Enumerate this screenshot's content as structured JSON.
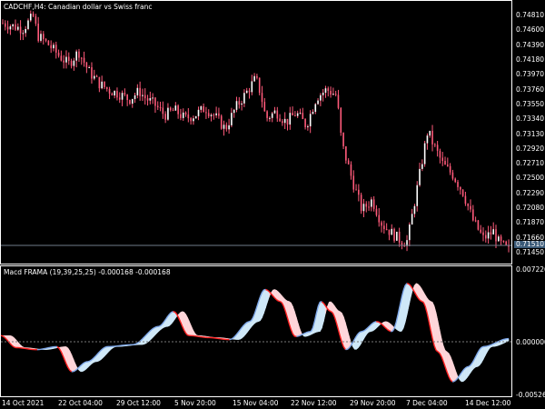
{
  "colors": {
    "background": "#000000",
    "frame": "#ffffff",
    "candle": "#ff5a7a",
    "candle_dark": "#b02040",
    "hist_up": "#cfe8f8",
    "hist_down": "#ffd6da",
    "line_up": "#7da6e8",
    "line_down": "#ff2020",
    "bid_line": "#6f7d8a",
    "bid_tag": "#3a5a78"
  },
  "chart": {
    "title": "CADCHF,H4: Canadian dollar vs Swiss franc",
    "price_ticks": [
      "0.74810",
      "0.74600",
      "0.74390",
      "0.74180",
      "0.73970",
      "0.73760",
      "0.73550",
      "0.73340",
      "0.73130",
      "0.72920",
      "0.72710",
      "0.72500",
      "0.72290",
      "0.72080",
      "0.71870",
      "0.71660",
      "0.71450"
    ],
    "bid_price": "0.71510"
  },
  "indicator": {
    "title": "Macd FRAMA (19,39,25,25) -0.000168 -0.000168",
    "ticks": [
      "0.007226",
      "0.000000",
      "-0.005262"
    ]
  },
  "time_axis": {
    "labels": [
      "14 Oct 2021",
      "22 Oct 04:00",
      "29 Oct 12:00",
      "5 Nov 20:00",
      "15 Nov 04:00",
      "22 Nov 12:00",
      "29 Nov 20:00",
      "7 Dec 04:00",
      "14 Dec 12:00"
    ]
  },
  "chart_data": {
    "type": "line",
    "title": "CADCHF,H4: Canadian dollar vs Swiss franc",
    "xlabel": "",
    "ylabel": "",
    "x_ticks": [
      "14 Oct 2021",
      "22 Oct 04:00",
      "29 Oct 12:00",
      "5 Nov 20:00",
      "15 Nov 04:00",
      "22 Nov 12:00",
      "29 Nov 20:00",
      "7 Dec 04:00",
      "14 Dec 12:00"
    ],
    "ylim": [
      0.714,
      0.7492
    ],
    "close_points": [
      [
        0,
        0.747
      ],
      [
        0.02,
        0.7466
      ],
      [
        0.04,
        0.7462
      ],
      [
        0.06,
        0.748
      ],
      [
        0.07,
        0.7452
      ],
      [
        0.09,
        0.744
      ],
      [
        0.11,
        0.7425
      ],
      [
        0.13,
        0.7412
      ],
      [
        0.15,
        0.743
      ],
      [
        0.17,
        0.7402
      ],
      [
        0.19,
        0.7385
      ],
      [
        0.21,
        0.7375
      ],
      [
        0.23,
        0.737
      ],
      [
        0.25,
        0.7362
      ],
      [
        0.27,
        0.7374
      ],
      [
        0.28,
        0.7365
      ],
      [
        0.3,
        0.7355
      ],
      [
        0.32,
        0.734
      ],
      [
        0.34,
        0.7347
      ],
      [
        0.36,
        0.7335
      ],
      [
        0.38,
        0.734
      ],
      [
        0.4,
        0.735
      ],
      [
        0.42,
        0.7338
      ],
      [
        0.44,
        0.732
      ],
      [
        0.46,
        0.735
      ],
      [
        0.48,
        0.737
      ],
      [
        0.5,
        0.7392
      ],
      [
        0.51,
        0.737
      ],
      [
        0.52,
        0.7335
      ],
      [
        0.54,
        0.7345
      ],
      [
        0.56,
        0.733
      ],
      [
        0.58,
        0.7343
      ],
      [
        0.6,
        0.7325
      ],
      [
        0.62,
        0.7365
      ],
      [
        0.64,
        0.7376
      ],
      [
        0.66,
        0.7368
      ],
      [
        0.67,
        0.73
      ],
      [
        0.69,
        0.725
      ],
      [
        0.71,
        0.7205
      ],
      [
        0.73,
        0.722
      ],
      [
        0.75,
        0.7185
      ],
      [
        0.77,
        0.7172
      ],
      [
        0.79,
        0.716
      ],
      [
        0.8,
        0.7162
      ],
      [
        0.82,
        0.724
      ],
      [
        0.84,
        0.7318
      ],
      [
        0.85,
        0.73
      ],
      [
        0.87,
        0.727
      ],
      [
        0.89,
        0.7255
      ],
      [
        0.91,
        0.723
      ],
      [
        0.93,
        0.719
      ],
      [
        0.95,
        0.7165
      ],
      [
        0.97,
        0.7175
      ],
      [
        0.98,
        0.716
      ],
      [
        1.0,
        0.7148
      ]
    ],
    "series": [
      {
        "values_note": "",
        "points": [
          [
            0,
            0.0006
          ],
          [
            0.03,
            -0.0006
          ],
          [
            0.07,
            -0.0008
          ],
          [
            0.11,
            -0.0005
          ],
          [
            0.14,
            -0.003
          ],
          [
            0.17,
            -0.002
          ],
          [
            0.21,
            -0.0005
          ],
          [
            0.26,
            -0.0003
          ],
          [
            0.31,
            0.0015
          ],
          [
            0.34,
            0.003
          ],
          [
            0.37,
            0.0006
          ],
          [
            0.41,
            0.0004
          ],
          [
            0.45,
            0.0002
          ],
          [
            0.49,
            0.002
          ],
          [
            0.52,
            0.0052
          ],
          [
            0.55,
            0.004
          ],
          [
            0.58,
            0.0005
          ],
          [
            0.61,
            0.001
          ],
          [
            0.63,
            0.004
          ],
          [
            0.65,
            0.003
          ],
          [
            0.68,
            -0.0008
          ],
          [
            0.71,
            0.001
          ],
          [
            0.74,
            0.002
          ],
          [
            0.77,
            0.001
          ],
          [
            0.8,
            0.0058
          ],
          [
            0.83,
            0.004
          ],
          [
            0.86,
            -0.001
          ],
          [
            0.89,
            -0.004
          ],
          [
            0.92,
            -0.0025
          ],
          [
            0.95,
            -0.0005
          ],
          [
            1.0,
            0.0003
          ]
        ]
      }
    ],
    "indicator_ylim": [
      -0.005262,
      0.007226
    ],
    "grid": false,
    "legend": "none"
  }
}
